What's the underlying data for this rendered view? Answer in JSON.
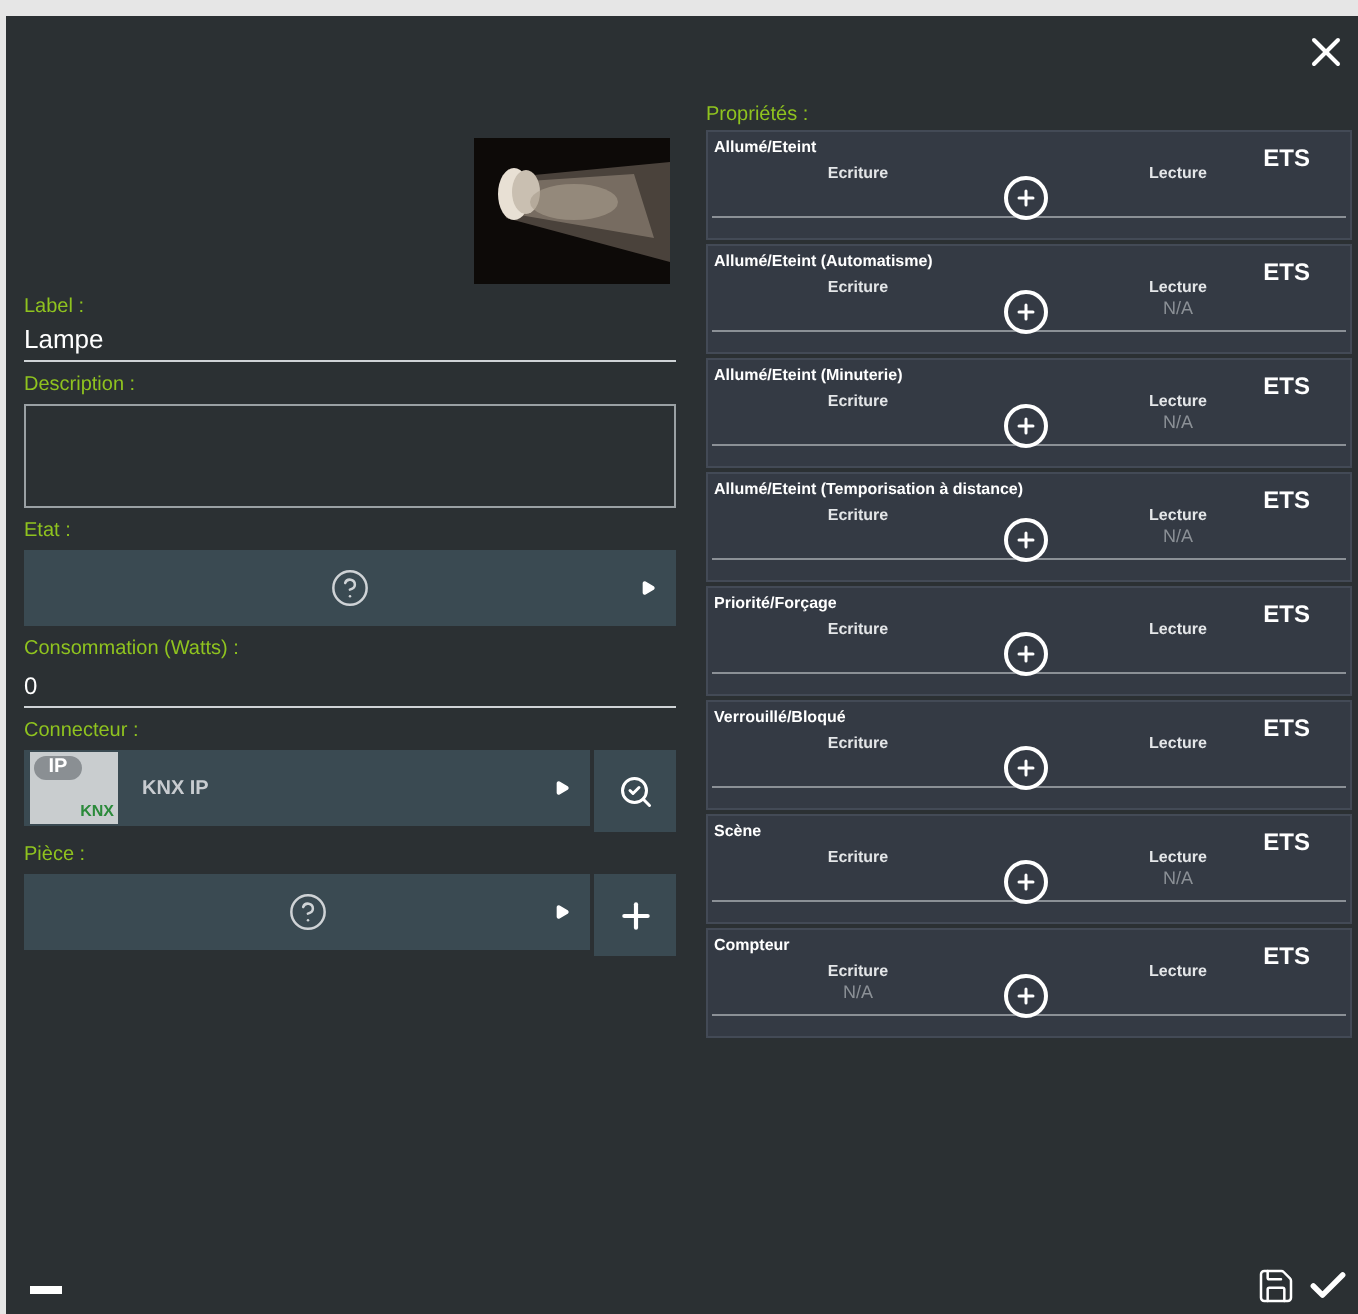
{
  "form": {
    "label": {
      "caption": "Label :",
      "value": "Lampe"
    },
    "description": {
      "caption": "Description :"
    },
    "etat": {
      "caption": "Etat :"
    },
    "consommation": {
      "caption": "Consommation (Watts) :",
      "value": "0"
    },
    "connecteur": {
      "caption": "Connecteur :",
      "value": "KNX IP"
    },
    "piece": {
      "caption": "Pièce :"
    }
  },
  "properties": {
    "caption": "Propriétés :",
    "items": [
      {
        "name": "Allumé/Eteint",
        "ets": "ETS",
        "write_label": "Ecriture",
        "read_label": "Lecture"
      },
      {
        "name": "Allumé/Eteint (Automatisme)",
        "ets": "ETS",
        "write_label": "Ecriture",
        "read_label": "Lecture",
        "read_value": "N/A"
      },
      {
        "name": "Allumé/Eteint (Minuterie)",
        "ets": "ETS",
        "write_label": "Ecriture",
        "read_label": "Lecture",
        "read_value": "N/A"
      },
      {
        "name": "Allumé/Eteint (Temporisation à distance)",
        "ets": "ETS",
        "write_label": "Ecriture",
        "read_label": "Lecture",
        "read_value": "N/A"
      },
      {
        "name": "Priorité/Forçage",
        "ets": "ETS",
        "write_label": "Ecriture",
        "read_label": "Lecture"
      },
      {
        "name": "Verrouillé/Bloqué",
        "ets": "ETS",
        "write_label": "Ecriture",
        "read_label": "Lecture"
      },
      {
        "name": "Scène",
        "ets": "ETS",
        "write_label": "Ecriture",
        "read_label": "Lecture",
        "read_value": "N/A"
      },
      {
        "name": "Compteur",
        "ets": "ETS",
        "write_label": "Ecriture",
        "read_label": "Lecture",
        "write_value": "N/A"
      }
    ]
  },
  "connector_logo": {
    "top": "IP",
    "bottom": "KNX"
  }
}
